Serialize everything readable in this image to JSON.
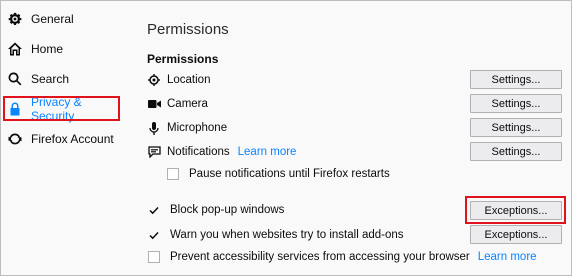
{
  "sidebar": {
    "items": [
      {
        "label": "General",
        "icon": "gear-icon"
      },
      {
        "label": "Home",
        "icon": "home-icon"
      },
      {
        "label": "Search",
        "icon": "search-icon"
      },
      {
        "label": "Privacy & Security",
        "icon": "lock-icon",
        "active": true
      },
      {
        "label": "Firefox Account",
        "icon": "sync-icon"
      }
    ]
  },
  "main": {
    "page_title": "Permissions",
    "section_title": "Permissions",
    "permissions": [
      {
        "label": "Location",
        "icon": "location-icon",
        "button": "Settings..."
      },
      {
        "label": "Camera",
        "icon": "camera-icon",
        "button": "Settings..."
      },
      {
        "label": "Microphone",
        "icon": "microphone-icon",
        "button": "Settings..."
      },
      {
        "label": "Notifications",
        "icon": "notification-icon",
        "link": "Learn more",
        "button": "Settings..."
      }
    ],
    "pause_notifications": {
      "label": "Pause notifications until Firefox restarts",
      "checked": false
    },
    "block_popups": {
      "label": "Block pop-up windows",
      "checked": true,
      "button": "Exceptions..."
    },
    "warn_addons": {
      "label": "Warn you when websites try to install add-ons",
      "checked": true,
      "button": "Exceptions..."
    },
    "prevent_accessibility": {
      "label": "Prevent accessibility services from accessing your browser",
      "checked": false,
      "link": "Learn more"
    }
  },
  "colors": {
    "accent": "#0a84ff",
    "highlight_box": "#e0121b"
  }
}
